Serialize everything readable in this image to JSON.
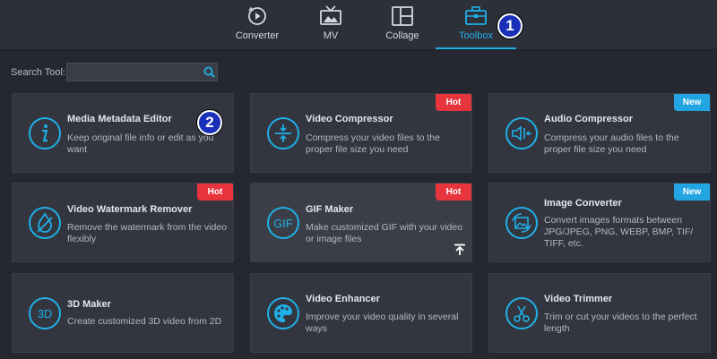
{
  "tabs": [
    {
      "id": "converter",
      "label": "Converter",
      "icon": "converter-icon",
      "active": false
    },
    {
      "id": "mv",
      "label": "MV",
      "icon": "tv-icon",
      "active": false
    },
    {
      "id": "collage",
      "label": "Collage",
      "icon": "collage-icon",
      "active": false
    },
    {
      "id": "toolbox",
      "label": "Toolbox",
      "icon": "toolbox-icon",
      "active": true
    }
  ],
  "annotations": [
    "1",
    "2"
  ],
  "search": {
    "label": "Search Tool:",
    "value": "",
    "placeholder": ""
  },
  "tags": {
    "hot": "Hot",
    "new": "New"
  },
  "colors": {
    "accent": "#1fb0e8",
    "hot": "#e8343c",
    "new": "#22a5e3",
    "marker": "#1a2fb8"
  },
  "tools": [
    {
      "title": "Media Metadata Editor",
      "desc": "Keep original file info or edit as you want",
      "icon": "info-icon"
    },
    {
      "title": "Video Compressor",
      "desc": "Compress your video files to the proper file size you need",
      "icon": "compress-icon",
      "tag": "Hot"
    },
    {
      "title": "Audio Compressor",
      "desc": "Compress your audio files to the proper file size you need",
      "icon": "audio-compress-icon",
      "tag": "New"
    },
    {
      "title": "Video Watermark Remover",
      "desc": "Remove the watermark from the video flexibly",
      "icon": "watermark-drop-icon",
      "tag": "Hot"
    },
    {
      "title": "GIF Maker",
      "desc": "Make customized GIF with your video or image files",
      "icon": "gif-icon",
      "tag": "Hot",
      "extra_icon": "upload-arrow-icon"
    },
    {
      "title": "Image Converter",
      "desc": "Convert images formats between JPG/JPEG, PNG, WEBP, BMP, TIF/ TIFF, etc.",
      "icon": "image-convert-icon",
      "tag": "New"
    },
    {
      "title": "3D Maker",
      "desc": "Create customized 3D video from 2D",
      "icon": "3d-icon",
      "icon_text": "3D"
    },
    {
      "title": "Video Enhancer",
      "desc": "Improve your video quality in several ways",
      "icon": "palette-icon"
    },
    {
      "title": "Video Trimmer",
      "desc": "Trim or cut your videos to the perfect length",
      "icon": "scissors-icon"
    }
  ]
}
